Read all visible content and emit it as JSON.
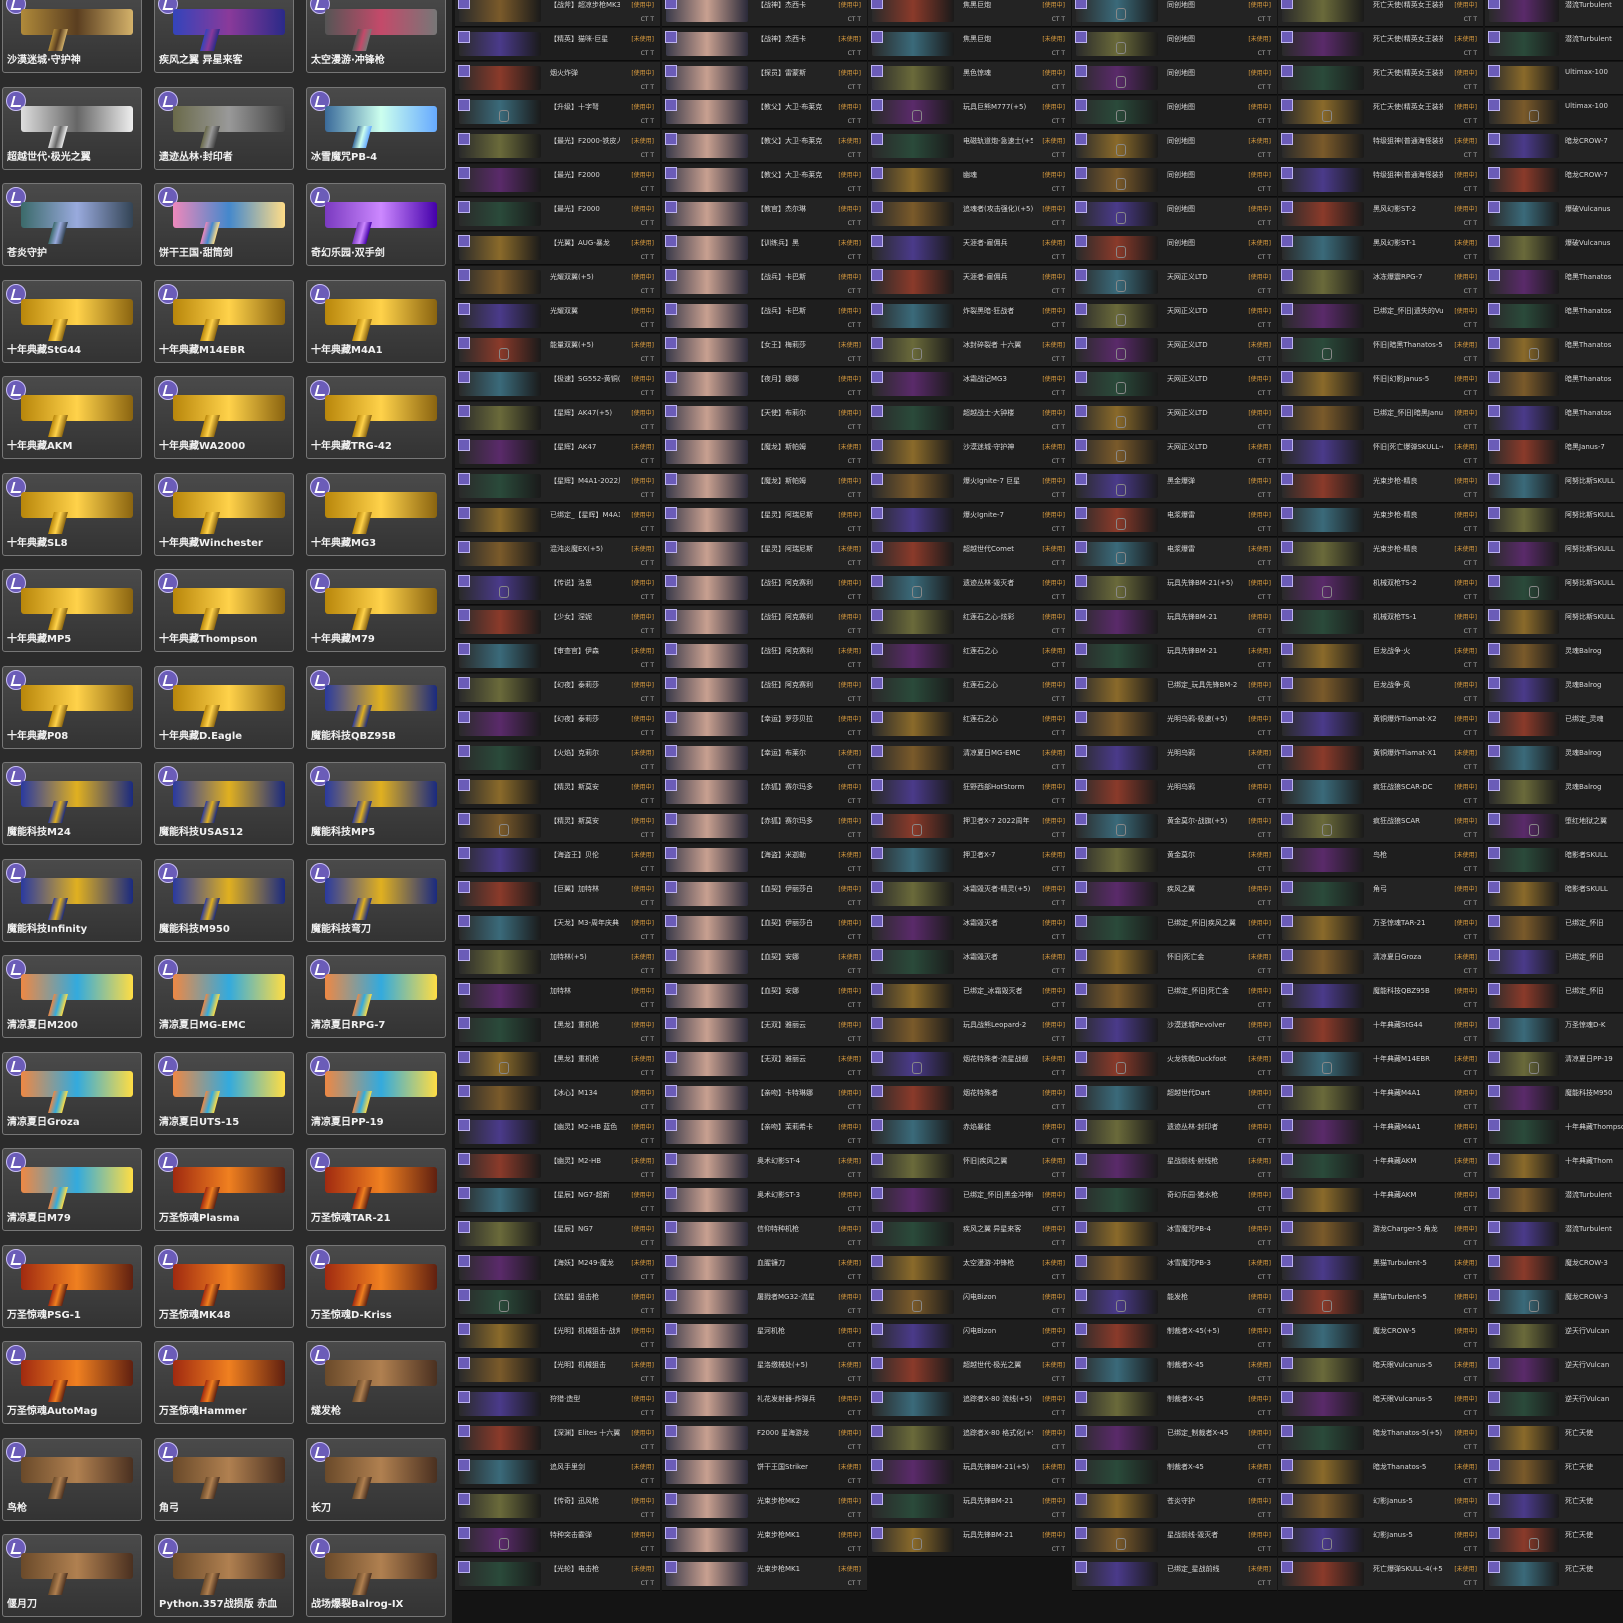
{
  "weapons": {
    "left_grid": [
      {
        "name": "沙漠迷城·守护神"
      },
      {
        "name": "疾风之翼 异星来客"
      },
      {
        "name": "太空漫游·冲锋枪"
      },
      {
        "name": "超越世代·极光之翼"
      },
      {
        "name": "遗迹丛林·封印者"
      },
      {
        "name": "冰雪魔咒PB-4"
      },
      {
        "name": "苍炎守护"
      },
      {
        "name": "饼干王国·甜筒剑"
      },
      {
        "name": "奇幻乐园·双手剑"
      },
      {
        "name": "十年典藏StG44"
      },
      {
        "name": "十年典藏M14EBR"
      },
      {
        "name": "十年典藏M4A1"
      },
      {
        "name": "十年典藏AKM"
      },
      {
        "name": "十年典藏WA2000"
      },
      {
        "name": "十年典藏TRG-42"
      },
      {
        "name": "十年典藏SL8"
      },
      {
        "name": "十年典藏Winchester"
      },
      {
        "name": "十年典藏MG3"
      },
      {
        "name": "十年典藏MP5"
      },
      {
        "name": "十年典藏Thompson"
      },
      {
        "name": "十年典藏M79"
      },
      {
        "name": "十年典藏P08"
      },
      {
        "name": "十年典藏D.Eagle"
      },
      {
        "name": "魔能科技QBZ95B"
      },
      {
        "name": "魔能科技M24"
      },
      {
        "name": "魔能科技USAS12"
      },
      {
        "name": "魔能科技MP5"
      },
      {
        "name": "魔能科技Infinity"
      },
      {
        "name": "魔能科技M950"
      },
      {
        "name": "魔能科技弯刀"
      },
      {
        "name": "清凉夏日M200"
      },
      {
        "name": "清凉夏日MG-EMC"
      },
      {
        "name": "清凉夏日RPG-7"
      },
      {
        "name": "清凉夏日Groza"
      },
      {
        "name": "清凉夏日UTS-15"
      },
      {
        "name": "清凉夏日PP-19"
      },
      {
        "name": "清凉夏日M79"
      },
      {
        "name": "万圣惊魂Plasma"
      },
      {
        "name": "万圣惊魂TAR-21"
      },
      {
        "name": "万圣惊魂PSG-1"
      },
      {
        "name": "万圣惊魂MK48"
      },
      {
        "name": "万圣惊魂D-Kriss"
      },
      {
        "name": "万圣惊魂AutoMag"
      },
      {
        "name": "万圣惊魂Hammer"
      },
      {
        "name": "燧发枪"
      },
      {
        "name": "鸟枪"
      },
      {
        "name": "角弓"
      },
      {
        "name": "长刀"
      },
      {
        "name": "偃月刀"
      },
      {
        "name": "Python.357战损版 赤血"
      },
      {
        "name": "战场爆裂Balrog-IX"
      }
    ],
    "col1": [
      "【战斧】超凉步枪MK3",
      "【精英】猫咪·巨星",
      "烟火炸弹",
      "【升级】十字弩",
      "【最光】F2000-铁皮人",
      "【最光】F2000",
      "【最光】F2000",
      "【光翼】AUG-暴龙",
      "光耀双翼(+5)",
      "光耀双翼",
      "能量双翼(+5)",
      "【极速】SG552-黄铜(+5)",
      "【星辉】AK47(+5)",
      "【星辉】AK47",
      "【星辉】M4A1-2022周年",
      "已绑定_【星辉】M4A1",
      "混沌炎魔EX(+5)",
      "【传说】洛恩",
      "【少女】涅妮",
      "【审查官】伊森",
      "【幻夜】泰莉莎",
      "【幻夜】泰莉莎",
      "【火焰】克莉尔",
      "【精灵】斯莫安",
      "【精灵】斯莫安",
      "【海盗王】贝伦",
      "【巨翼】加特林",
      "【天龙】M3-周年庆典",
      "加特林(+5)",
      "加特林",
      "【黑龙】重机枪",
      "【黑龙】重机枪",
      "【冰心】M134",
      "【幽灵】M2-HB 蓝色",
      "【幽灵】M2-HB",
      "【星辰】NG7-超新",
      "【星辰】NG7",
      "【海妖】M249-魔龙",
      "【流星】狙击枪",
      "【光明】机械狙击-战斧",
      "【光明】机械狙击",
      "狩猎·造型",
      "【深渊】Elites 十六翼",
      "追风手里剑",
      "【传奇】迅风枪",
      "特种突击霰弹",
      "【光轮】电击枪"
    ],
    "col2": [
      "【战神】杰西卡",
      "【战神】杰西卡",
      "【探员】雷蒙斯",
      "【教父】大卫·布莱克",
      "【教父】大卫·布莱克",
      "【教父】大卫·布莱克",
      "【教官】杰尔琳",
      "【训练兵】黑",
      "【战兵】卡巴斯",
      "【战兵】卡巴斯",
      "【女王】梅莉莎",
      "【夜月】娜娜",
      "【天使】布莉尔",
      "【魔龙】斯帕姆",
      "【魔龙】斯帕姆",
      "【星灵】阿瑞尼斯",
      "【星灵】阿瑞尼斯",
      "【战狂】阿克赛利",
      "【战狂】阿克赛利",
      "【战狂】阿克赛利",
      "【战狂】阿克赛利",
      "【幸运】罗莎贝拉",
      "【幸运】布莱尔",
      "【赤狐】赛尔玛多",
      "【赤狐】赛尔玛多",
      "【海盗】米迦勒",
      "【血契】伊丽莎白",
      "【血契】伊丽莎白",
      "【血契】安娜",
      "【血契】安娜",
      "【无双】雅丽云",
      "【无双】雅丽云",
      "【亲吻】卡特琳娜",
      "【亲吻】茉莉希卡",
      "奥术幻影ST-4",
      "奥术幻影ST-3",
      "信仰特种机枪",
      "血腥镰刀",
      "屠戮者MG32-流星",
      "星河机枪",
      "星洛缴械处(+5)",
      "礼花发射器-炸弹兵",
      "F2000 星海游龙",
      "饼干王国Striker",
      "光束步枪MK2",
      "光束步枪MK1",
      "光束步枪MK1"
    ],
    "col3": [
      "焦黑巨炮",
      "焦黑巨炮",
      "黑色惊魂",
      "玩具巨熊M777(+5)",
      "电磁轨道炮-急速士(+5)",
      "幽魂",
      "追魂者(攻击强化)(+5)",
      "天涯者-雇佣兵",
      "天涯者-雇佣兵",
      "炸裂黑暗·狂战者",
      "冰封碎裂者 十六翼",
      "冰霜战记MG3",
      "超越战士·大钟楼",
      "沙漠迷城·守护神",
      "爆火Ignite-7 巨星",
      "爆火Ignite-7",
      "超越世代Comet",
      "遗迹丛林·毁灭者",
      "红莲石之心-炫彩",
      "红莲石之心",
      "红莲石之心",
      "红莲石之心",
      "清凉夏日MG-EMC",
      "狂野西部HotStorm",
      "押卫者X-7 2022周年",
      "押卫者X-7",
      "冰霜毁灭者-精灵(+5)",
      "冰霜毁灭者",
      "冰霜毁灭者",
      "已绑定_冰霜毁灭者",
      "玩具战熊Leopard-2",
      "烟花特殊者-流星战舰",
      "烟花特殊者",
      "赤焰暴徒",
      "怀旧|疾风之翼",
      "已绑定_怀旧|黑金冲锋MP5",
      "疾风之翼 异星来客",
      "太空漫游·冲锋枪",
      "闪电Bizon",
      "闪电Bizon",
      "超越世代·极光之翼",
      "追踪者X-80 流线(+5)",
      "追踪者X-80 格式化(+5)",
      "玩具先锋BM-21(+5)",
      "玩具先锋BM-21",
      "玩具先锋BM-21"
    ],
    "col4": [
      "同创地图",
      "同创地图",
      "同创地图",
      "同创地图",
      "同创地图",
      "同创地图",
      "同创地图",
      "同创地图",
      "天网正义LTD",
      "天网正义LTD",
      "天网正义LTD",
      "天网正义LTD",
      "天网正义LTD",
      "天网正义LTD",
      "黑金爆弹",
      "电浆爆雷",
      "电浆爆雷",
      "玩具先锋BM-21(+5)",
      "玩具先锋BM-21",
      "玩具先锋BM-21",
      "已绑定_玩具先锋BM-21",
      "光明乌鸦-极速(+5)",
      "光明乌鸦",
      "光明乌鸦",
      "黄金莫尔-战旗(+5)",
      "黄金莫尔",
      "疾风之翼",
      "已绑定_怀旧|疾风之翼",
      "怀旧|死亡金",
      "已绑定_怀旧|死亡金",
      "沙漠迷城Revolver",
      "火龙铁戟Duckfoot",
      "超越世代Dart",
      "遗迹丛林·封印者",
      "星战前线·射线枪",
      "奇幻乐园·猪水枪",
      "冰雪魔咒PB-4",
      "冰雪魔咒PB-3",
      "能发枪",
      "制裁者X-45(+5)",
      "制裁者X-45",
      "制裁者X-45",
      "已绑定_制裁者X-45",
      "制裁者X-45",
      "苍炎守护",
      "星战前线·毁灭者",
      "已绑定_星战前线"
    ],
    "col5": [
      "死亡天使(精英女王装扮)",
      "死亡天使(精英女王装扮)",
      "死亡天使(精英女王装扮)",
      "死亡天使(精英女王装扮)",
      "特级狙神(普通海怪装扮)",
      "特级狙神(普通海怪装扮)",
      "黑风幻影ST-2",
      "黑风幻影ST-1",
      "冰冻爆震RPG-7",
      "已绑定_怀旧|遗失的Vulcanus",
      "怀旧|暗黑Thanatos-5",
      "怀旧|幻影Janus-5",
      "已绑定_怀旧|暗黑Janus",
      "怀旧|死亡爆弹SKULL-4",
      "光束步枪-精良",
      "光束步枪-精良",
      "光束步枪-精良",
      "机械双枪TS-2",
      "机械双枪TS-1",
      "巨龙战争·火",
      "巨龙战争·风",
      "黄铜爆炸Tiamat-X2",
      "黄铜爆炸Tiamat-X1",
      "疯狂战狼SCAR-DC",
      "疯狂战狼SCAR",
      "鸟枪",
      "角弓",
      "万圣惊魂TAR-21",
      "清凉夏日Groza",
      "魔能科技QBZ95B",
      "十年典藏StG44",
      "十年典藏M14EBR",
      "十年典藏M4A1",
      "十年典藏M4A1",
      "十年典藏AKM",
      "十年典藏AKM",
      "游龙Charger-5 角龙",
      "黑猫Turbulent-5",
      "黑猫Turbulent-5",
      "魔龙CROW-5",
      "暗天眼Vulcanus-5",
      "暗天眼Vulcanus-5",
      "暗龙Thanatos-5(+5)",
      "暗龙Thanatos-5",
      "幻影Janus-5",
      "幻影Janus-5",
      "死亡爆弹SKULL-4(+5)"
    ],
    "col6": [
      "潜流Turbulent",
      "潜流Turbulent",
      "Ultimax-100",
      "Ultimax-100",
      "暗龙CROW-7",
      "暗龙CROW-7",
      "爆破Vulcanus",
      "爆破Vulcanus",
      "暗黑Thanatos",
      "暗黑Thanatos",
      "暗黑Thanatos",
      "暗黑Thanatos",
      "暗黑Thanatos",
      "暗黑Janus-7",
      "阿努比斯SKULL",
      "阿努比斯SKULL",
      "阿努比斯SKULL",
      "阿努比斯SKULL",
      "阿努比斯SKULL",
      "灵魂Balrog",
      "灵魂Balrog",
      "已绑定_灵魂",
      "灵魂Balrog",
      "灵魂Balrog",
      "堕红地狱之翼",
      "暗影者SKULL",
      "暗影者SKULL",
      "已绑定_怀旧",
      "已绑定_怀旧",
      "已绑定_怀旧",
      "万圣惊魂D-K",
      "清凉夏日PP-19",
      "魔能科技M950",
      "十年典藏Thompson",
      "十年典藏Thom",
      "潜流Turbulent",
      "潜流Turbulent",
      "魔龙CROW-3",
      "魔龙CROW-3",
      "逆天行Vulcan",
      "逆天行Vulcan",
      "逆天行Vulcan",
      "死亡天使",
      "死亡天使",
      "死亡天使",
      "死亡天使",
      "死亡天使"
    ],
    "status_labels": {
      "in_use": "[使用中]",
      "unused": "[未使用]",
      "team": "CT T"
    }
  },
  "colors": {
    "purple_badge": "#6b5cb8",
    "gold": "#d9a21b",
    "status_orange": "#e0a040"
  }
}
